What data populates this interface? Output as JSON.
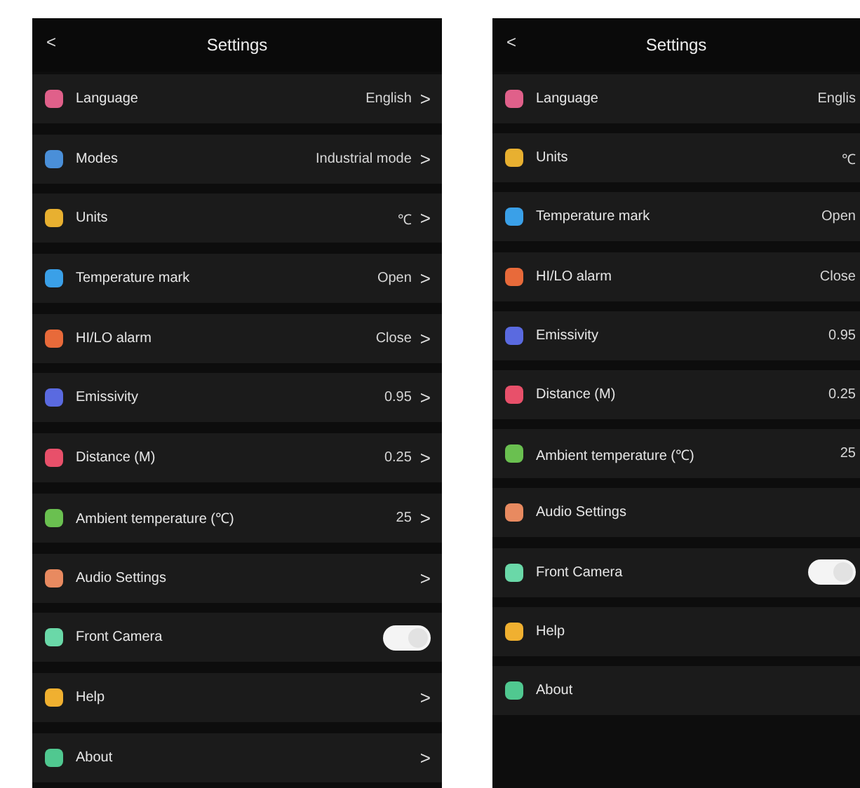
{
  "screens": [
    {
      "header": {
        "back": "<",
        "title": "Settings"
      },
      "rows": [
        {
          "kind": "link",
          "label": "Language",
          "value": "English",
          "chevron": ">",
          "color": "#e0608a"
        },
        {
          "kind": "link",
          "label": "Modes",
          "value": "Industrial mode",
          "chevron": ">",
          "color": "#4a8fd8"
        },
        {
          "kind": "link",
          "label": "Units",
          "value": "℃",
          "chevron": ">",
          "color": "#e8b030"
        },
        {
          "kind": "link",
          "label": "Temperature mark",
          "value": "Open",
          "chevron": ">",
          "color": "#3aa0e8"
        },
        {
          "kind": "link",
          "label": "HI/LO alarm",
          "value": "Close",
          "chevron": ">",
          "color": "#e86a3a"
        },
        {
          "kind": "link",
          "label": "Emissivity",
          "value": "0.95",
          "chevron": ">",
          "color": "#5a6ae0"
        },
        {
          "kind": "link",
          "label": "Distance (M)",
          "value": "0.25",
          "chevron": ">",
          "color": "#e8506a"
        },
        {
          "kind": "link",
          "label": "Ambient temperature (℃)",
          "value": "25",
          "chevron": ">",
          "color": "#6ac050"
        },
        {
          "kind": "link",
          "label": "Audio Settings",
          "chevron": ">",
          "color": "#e88a60"
        },
        {
          "kind": "toggle",
          "label": "Front Camera",
          "on": true,
          "color": "#6ad8a8"
        },
        {
          "kind": "link",
          "label": "Help",
          "chevron": ">",
          "color": "#f0b030"
        },
        {
          "kind": "link",
          "label": "About",
          "chevron": ">",
          "color": "#50c890"
        }
      ]
    },
    {
      "header": {
        "back": "<",
        "title": "Settings"
      },
      "rows": [
        {
          "kind": "value",
          "label": "Language",
          "value": "Englis",
          "color": "#e0608a"
        },
        {
          "kind": "value",
          "label": "Units",
          "value": "℃",
          "color": "#e8b030"
        },
        {
          "kind": "value",
          "label": "Temperature mark",
          "value": "Open",
          "color": "#3aa0e8"
        },
        {
          "kind": "value",
          "label": "HI/LO alarm",
          "value": "Close",
          "color": "#e86a3a"
        },
        {
          "kind": "value",
          "label": "Emissivity",
          "value": "0.95",
          "color": "#5a6ae0"
        },
        {
          "kind": "value",
          "label": "Distance (M)",
          "value": "0.25",
          "color": "#e8506a"
        },
        {
          "kind": "value",
          "label": "Ambient temperature (℃)",
          "value": "25",
          "color": "#6ac050"
        },
        {
          "kind": "value",
          "label": "Audio Settings",
          "color": "#e88a60"
        },
        {
          "kind": "toggle",
          "label": "Front Camera",
          "on": true,
          "color": "#6ad8a8"
        },
        {
          "kind": "value",
          "label": "Help",
          "color": "#f0b030"
        },
        {
          "kind": "value",
          "label": "About",
          "color": "#50c890"
        }
      ]
    }
  ]
}
